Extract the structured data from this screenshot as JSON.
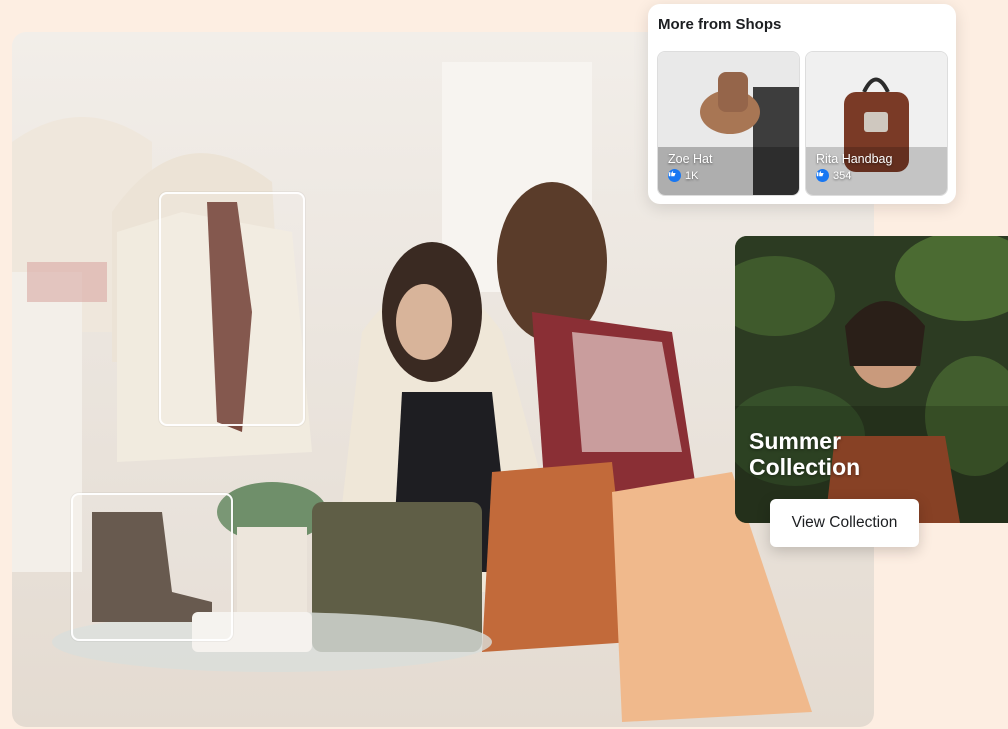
{
  "shops_card": {
    "title": "More from Shops",
    "items": [
      {
        "name": "Zoe Hat",
        "likes": "1K",
        "icon": "like-icon"
      },
      {
        "name": "Rita Handbag",
        "likes": "354",
        "icon": "like-icon"
      }
    ]
  },
  "collection_card": {
    "title_line1": "Summer",
    "title_line2": "Collection",
    "button_label": "View Collection"
  },
  "colors": {
    "background": "#fdeee2",
    "like_blue": "#1877f2"
  }
}
